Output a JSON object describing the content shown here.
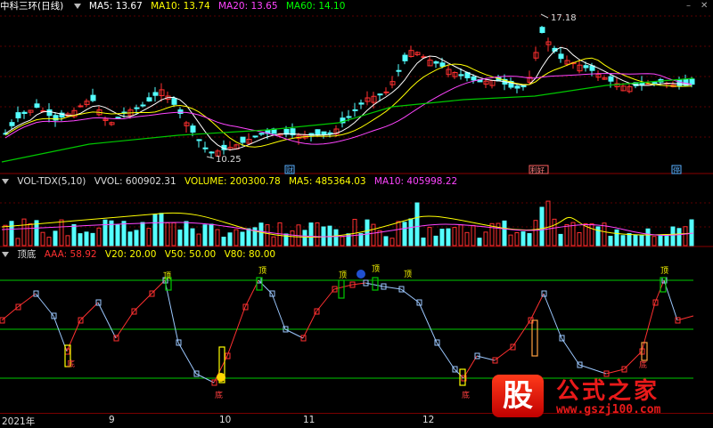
{
  "panels": {
    "main": {
      "title": "中科三环(日线)",
      "indicators": [
        {
          "label": "MA5: 13.67",
          "color": "#ffffff"
        },
        {
          "label": "MA10: 13.74",
          "color": "#ffff00"
        },
        {
          "label": "MA20: 13.65",
          "color": "#ff00ff"
        },
        {
          "label": "MA60: 14.10",
          "color": "#00ff00"
        }
      ],
      "high_label": "17.18",
      "low_label": "10.25",
      "markers": [
        "财",
        "利好",
        "停"
      ]
    },
    "volume": {
      "title": "VOL-TDX(5,10)",
      "indicators": [
        {
          "label": "VVOL: 600902.31",
          "color": "#cccccc"
        },
        {
          "label": "VOLUME: 200300.78",
          "color": "#ffff00"
        },
        {
          "label": "MA5: 485364.03",
          "color": "#ffff00"
        },
        {
          "label": "MA10: 405998.22",
          "color": "#ff00ff"
        }
      ]
    },
    "indicator": {
      "title": "顶底",
      "indicators": [
        {
          "label": "AAA: 58.92",
          "color": "#ff3030"
        },
        {
          "label": "V20: 20.00",
          "color": "#ffff00"
        },
        {
          "label": "V50: 50.00",
          "color": "#ffff00"
        },
        {
          "label": "V80: 80.00",
          "color": "#ffff00"
        }
      ],
      "top_label": "顶",
      "bottom_label": "底"
    }
  },
  "x_axis": {
    "year_label": "2021年",
    "months": [
      "9",
      "10",
      "11",
      "12"
    ]
  },
  "watermark": {
    "logo_char": "股",
    "site_name": "公式之家",
    "url": "www.gszj100.com"
  },
  "colors": {
    "up": "#ff3030",
    "down": "#54ffff",
    "background": "#000000"
  }
}
